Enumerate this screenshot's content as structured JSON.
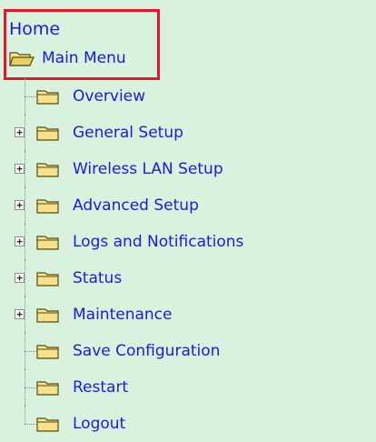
{
  "header": {
    "home_label": "Home",
    "main_menu_label": "Main Menu"
  },
  "menu": {
    "items": [
      {
        "label": "Overview",
        "expandable": false
      },
      {
        "label": "General Setup",
        "expandable": true
      },
      {
        "label": "Wireless LAN Setup",
        "expandable": true
      },
      {
        "label": "Advanced Setup",
        "expandable": true
      },
      {
        "label": "Logs and Notifications",
        "expandable": true
      },
      {
        "label": "Status",
        "expandable": true
      },
      {
        "label": "Maintenance",
        "expandable": true
      },
      {
        "label": "Save Configuration",
        "expandable": false
      },
      {
        "label": "Restart",
        "expandable": false
      },
      {
        "label": "Logout",
        "expandable": false
      }
    ],
    "expander_glyph": "+",
    "folder_icon": "folder-icon",
    "open_folder_icon": "open-folder-icon"
  },
  "colors": {
    "background": "#d8f2de",
    "link": "#1a1ae6",
    "highlight_border": "#e8142b",
    "folder_fill": "#f5e38c",
    "folder_outline": "#5a4a12"
  }
}
